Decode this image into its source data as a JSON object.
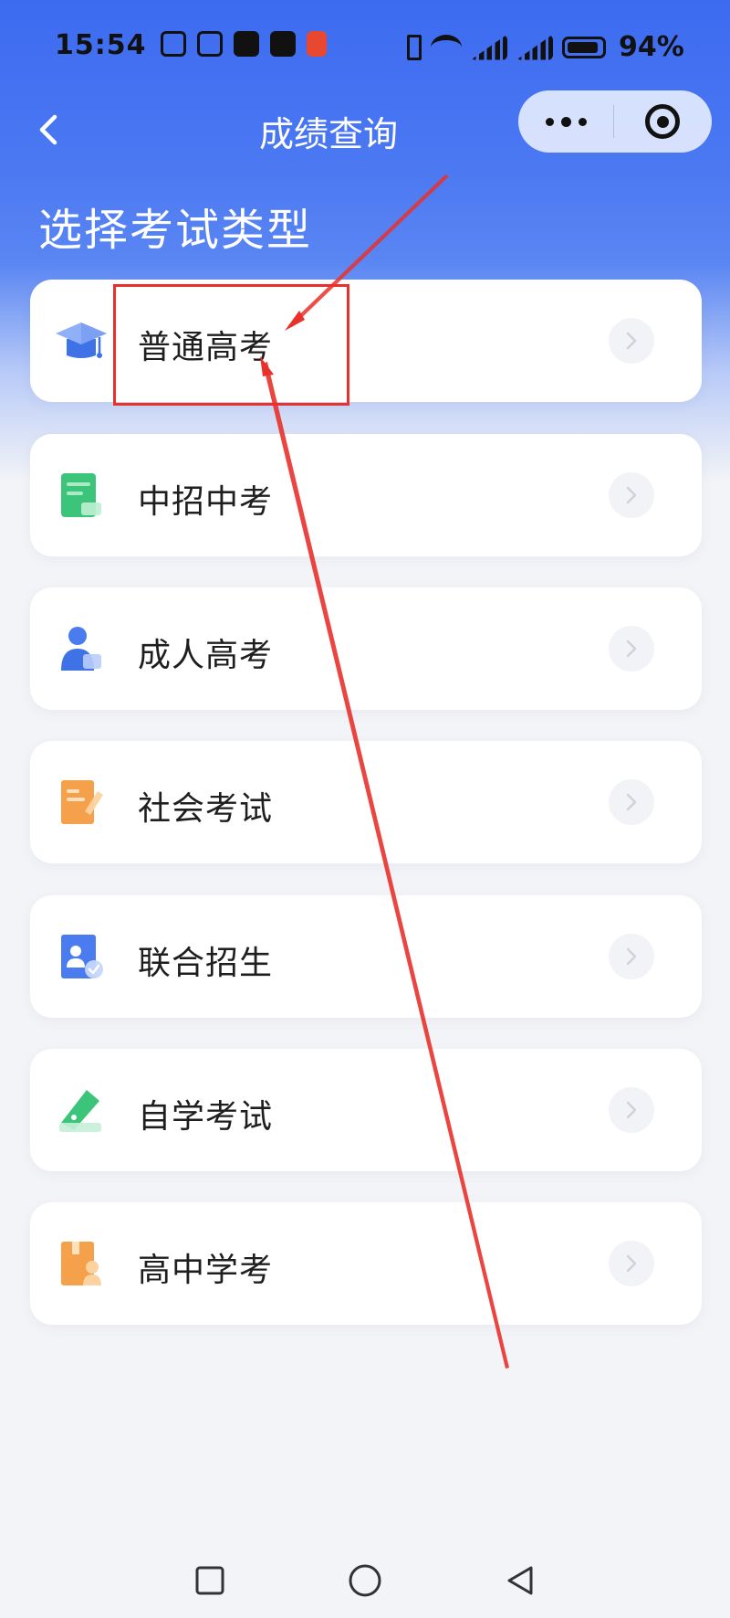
{
  "status_bar": {
    "time": "15:54",
    "battery_text": "94%"
  },
  "header": {
    "title": "成绩查询"
  },
  "section": {
    "heading": "选择考试类型"
  },
  "exam_types": [
    {
      "label": "普通高考",
      "icon": "graduation-cap-icon",
      "color": "#4a7cf0"
    },
    {
      "label": "中招中考",
      "icon": "notebook-icon",
      "color": "#3cc57a"
    },
    {
      "label": "成人高考",
      "icon": "person-icon",
      "color": "#4a7cf0"
    },
    {
      "label": "社会考试",
      "icon": "document-edit-icon",
      "color": "#f5a04a"
    },
    {
      "label": "联合招生",
      "icon": "id-card-icon",
      "color": "#4a7cf0"
    },
    {
      "label": "自学考试",
      "icon": "pen-icon",
      "color": "#3cc57a"
    },
    {
      "label": "高中学考",
      "icon": "book-person-icon",
      "color": "#f5a04a"
    }
  ],
  "annotation": {
    "highlight_color": "#e8312b",
    "highlighted_item": "普通高考"
  }
}
